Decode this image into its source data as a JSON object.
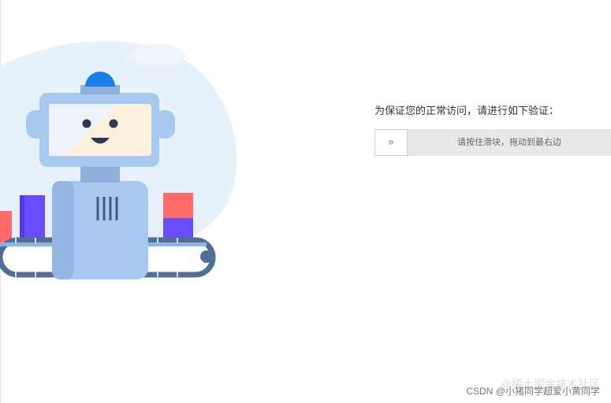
{
  "verify": {
    "title": "为保证您的正常访问，请进行如下验证：",
    "slider_hint": "请按住滑块，拖动到最右边",
    "handle_icon": "double-chevron-right-icon",
    "handle_glyph": "»"
  },
  "watermark": {
    "back_text": "@稀土掘金技术社区",
    "front_text": "CSDN @小猪同学超爱小黄同学"
  },
  "colors": {
    "blob": "#e6f1fb",
    "robot_body": "#a8c9ef",
    "robot_dark": "#3d5a80",
    "dome": "#1a7fe0",
    "belt": "#4f6f95",
    "box_red": "#ff6b6b",
    "box_purple": "#6a4cff",
    "screen_fill": "#fdf0dc"
  }
}
